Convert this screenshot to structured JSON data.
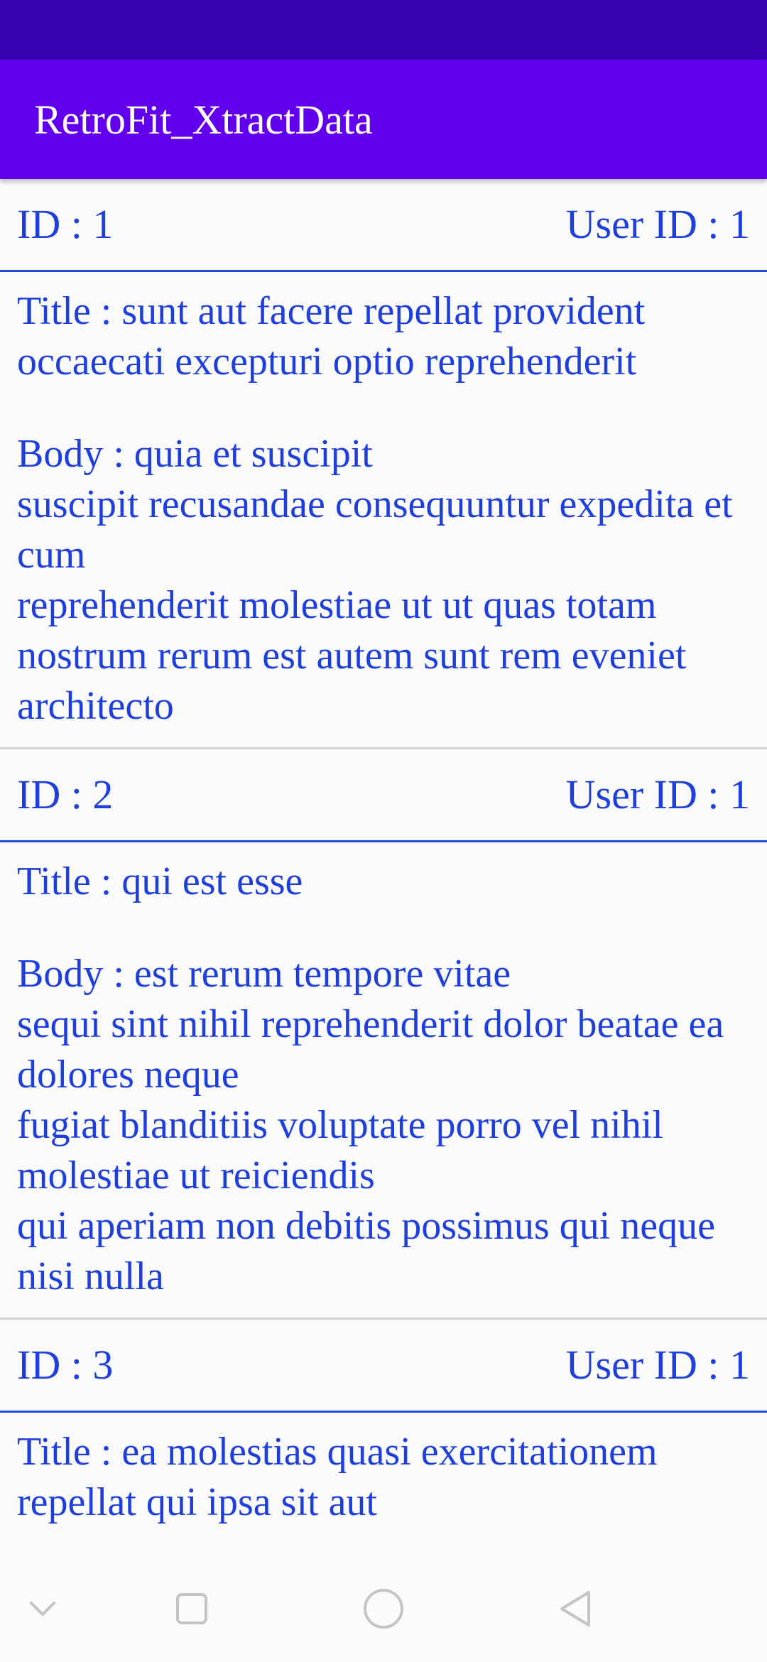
{
  "app_bar": {
    "title": "RetroFit_XtractData"
  },
  "posts": [
    {
      "id_text": "ID : 1",
      "user_id_text": "User ID : 1",
      "title_text": "Title : sunt aut facere repellat provident occaecati excepturi optio reprehenderit",
      "body_text": "Body : quia et suscipit\nsuscipit recusandae consequuntur expedita et cum\nreprehenderit molestiae ut ut quas totam\nnostrum rerum est autem sunt rem eveniet architecto"
    },
    {
      "id_text": "ID : 2",
      "user_id_text": "User ID : 1",
      "title_text": "Title : qui est esse",
      "body_text": "Body : est rerum tempore vitae\nsequi sint nihil reprehenderit dolor beatae ea dolores neque\nfugiat blanditiis voluptate porro vel nihil molestiae ut reiciendis\nqui aperiam non debitis possimus qui neque nisi nulla"
    },
    {
      "id_text": "ID : 3",
      "user_id_text": "User ID : 1",
      "title_text": "Title : ea molestias quasi exercitationem repellat qui ipsa sit aut",
      "body_text": ""
    }
  ],
  "nav_bar": {
    "icons": [
      "chevron-down-icon",
      "recents-square-icon",
      "home-circle-icon",
      "back-triangle-icon"
    ]
  },
  "colors": {
    "status_bar": "#3700b3",
    "app_bar": "#6200ee",
    "text": "#1f3fdc",
    "header_divider": "#1f4fd6",
    "item_divider": "#d3d3d3",
    "background": "#fafafa",
    "nav_icon": "#c4c4c4"
  }
}
